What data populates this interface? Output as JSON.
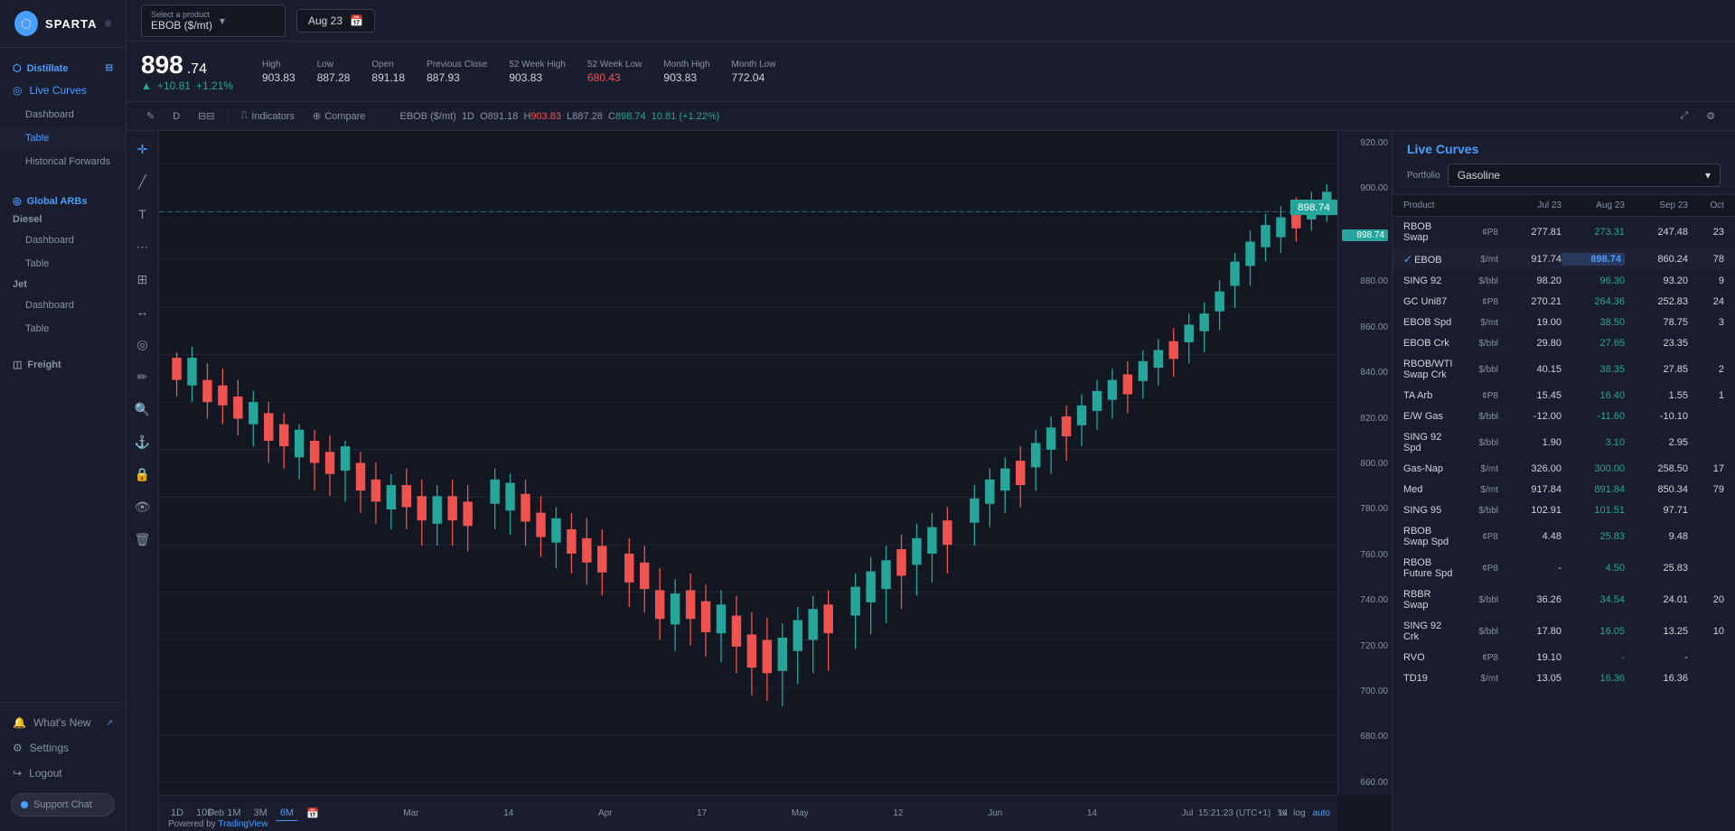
{
  "sidebar": {
    "logo": "SPARTA",
    "sections": [
      {
        "label": "Distillate",
        "icon": "⬡",
        "items": [
          {
            "label": "Live Curves",
            "active": true,
            "sub": false
          },
          {
            "label": "Dashboard",
            "sub": true
          },
          {
            "label": "Table",
            "sub": true,
            "active": true
          },
          {
            "label": "Historical Forwards",
            "sub": true
          }
        ]
      },
      {
        "label": "Global ARBs",
        "icon": "◎",
        "items": [
          {
            "label": "Diesel",
            "sub": false
          },
          {
            "label": "Dashboard",
            "sub": true
          },
          {
            "label": "Table",
            "sub": true
          },
          {
            "label": "Jet",
            "sub": false
          },
          {
            "label": "Dashboard",
            "sub": true
          },
          {
            "label": "Table",
            "sub": true
          }
        ]
      },
      {
        "label": "Freight",
        "icon": "◫"
      }
    ],
    "bottom": [
      {
        "label": "What's New",
        "icon": "🔔"
      },
      {
        "label": "Settings",
        "icon": "⚙"
      },
      {
        "label": "Logout",
        "icon": "↪"
      }
    ],
    "support_label": "Support Chat"
  },
  "topbar": {
    "product_label": "Select a product",
    "product_value": "EBOB ($/mt)",
    "date_label": "Aug 23",
    "calendar_icon": "📅"
  },
  "price_header": {
    "price_main": "898",
    "price_decimal": ".74",
    "change_amount": "+10.81",
    "change_pct": "+1.21%",
    "high_label": "High",
    "high_value": "903.83",
    "low_label": "Low",
    "low_value": "887.28",
    "open_label": "Open",
    "open_value": "891.18",
    "prev_close_label": "Previous Close",
    "prev_close_value": "887.93",
    "week52_high_label": "52 Week High",
    "week52_high_value": "903.83",
    "week52_low_label": "52 Week Low",
    "week52_low_value": "680.43",
    "month_high_label": "Month High",
    "month_high_value": "903.83",
    "month_low_label": "Month Low",
    "month_low_value": "772.04"
  },
  "chart_toolbar": {
    "timeframes": [
      "D",
      "||"
    ],
    "ohlc": "EBOB ($/mt)  1D  O891.18  H903.83  L887.28  C898.74  10.81 (+1.22%)",
    "indicators_label": "Indicators",
    "compare_label": "Compare"
  },
  "chart": {
    "y_labels": [
      "920.00",
      "900.00",
      "880.00",
      "860.00",
      "840.00",
      "820.00",
      "800.00",
      "780.00",
      "760.00",
      "740.00",
      "720.00",
      "700.00",
      "680.00",
      "660.00"
    ],
    "current_price": "898.74",
    "x_labels": [
      "Feb",
      "14",
      "Mar",
      "14",
      "Apr",
      "17",
      "May",
      "12",
      "Jun",
      "14",
      "Jul",
      "14"
    ],
    "timeframe_btns": [
      "1D",
      "10D",
      "1M",
      "3M",
      "6M",
      "📅"
    ],
    "active_tf": "6M",
    "bottom_info": "15:21:23 (UTC+1)",
    "pct_label": "%",
    "log_label": "log",
    "auto_label": "auto"
  },
  "right_panel": {
    "title": "Live Curves",
    "portfolio_label": "Portfolio",
    "portfolio_value": "Gasoline",
    "columns": [
      "Product",
      "",
      "Jul 23",
      "Aug 23",
      "Sep 23",
      "Oct"
    ],
    "rows": [
      {
        "name": "RBOB Swap",
        "unit": "¢P8",
        "jul": "277.81",
        "aug": "273.31",
        "sep": "247.48",
        "oct": "23",
        "selected": false
      },
      {
        "name": "EBOB",
        "unit": "$/mt",
        "jul": "917.74",
        "aug": "898.74",
        "sep": "860.24",
        "oct": "78",
        "selected": true
      },
      {
        "name": "SING 92",
        "unit": "$/bbl",
        "jul": "98.20",
        "aug": "96.30",
        "sep": "93.20",
        "oct": "9",
        "selected": false
      },
      {
        "name": "GC Uni87",
        "unit": "¢P8",
        "jul": "270.21",
        "aug": "264.36",
        "sep": "252.83",
        "oct": "24",
        "selected": false
      },
      {
        "name": "EBOB Spd",
        "unit": "$/mt",
        "jul": "19.00",
        "aug": "38.50",
        "sep": "78.75",
        "oct": "3",
        "selected": false
      },
      {
        "name": "EBOB Crk",
        "unit": "$/bbl",
        "jul": "29.80",
        "aug": "27.65",
        "sep": "23.35",
        "oct": "",
        "selected": false
      },
      {
        "name": "RBOB/WTI Swap Crk",
        "unit": "$/bbl",
        "jul": "40.15",
        "aug": "38.35",
        "sep": "27.85",
        "oct": "2",
        "selected": false
      },
      {
        "name": "TA Arb",
        "unit": "¢P8",
        "jul": "15.45",
        "aug": "16.40",
        "sep": "1.55",
        "oct": "1",
        "selected": false
      },
      {
        "name": "E/W Gas",
        "unit": "$/bbl",
        "jul": "-12.00",
        "aug": "-11.60",
        "sep": "-10.10",
        "oct": "",
        "selected": false
      },
      {
        "name": "SING 92 Spd",
        "unit": "$/bbl",
        "jul": "1.90",
        "aug": "3.10",
        "sep": "2.95",
        "oct": "",
        "selected": false
      },
      {
        "name": "Gas-Nap",
        "unit": "$/mt",
        "jul": "326.00",
        "aug": "300.00",
        "sep": "258.50",
        "oct": "17",
        "selected": false
      },
      {
        "name": "Med",
        "unit": "$/mt",
        "jul": "917.84",
        "aug": "891.84",
        "sep": "850.34",
        "oct": "79",
        "selected": false
      },
      {
        "name": "SING 95",
        "unit": "$/bbl",
        "jul": "102.91",
        "aug": "101.51",
        "sep": "97.71",
        "oct": "",
        "selected": false
      },
      {
        "name": "RBOB Swap Spd",
        "unit": "¢P8",
        "jul": "4.48",
        "aug": "25.83",
        "sep": "9.48",
        "oct": "",
        "selected": false
      },
      {
        "name": "RBOB Future Spd",
        "unit": "¢P8",
        "jul": "-",
        "aug": "4.50",
        "sep": "25.83",
        "oct": "",
        "selected": false
      },
      {
        "name": "RBBR Swap",
        "unit": "$/bbl",
        "jul": "36.26",
        "aug": "34.54",
        "sep": "24.01",
        "oct": "20",
        "selected": false
      },
      {
        "name": "SING 92 Crk",
        "unit": "$/bbl",
        "jul": "17.80",
        "aug": "16.05",
        "sep": "13.25",
        "oct": "10",
        "selected": false
      },
      {
        "name": "RVO",
        "unit": "¢P8",
        "jul": "19.10",
        "aug": "-",
        "sep": "-",
        "oct": "",
        "selected": false
      },
      {
        "name": "TD19",
        "unit": "$/mt",
        "jul": "13.05",
        "aug": "16.36",
        "sep": "16.36",
        "oct": "",
        "selected": false
      }
    ]
  },
  "powered_by": "Powered by",
  "trading_view": "TradingView"
}
